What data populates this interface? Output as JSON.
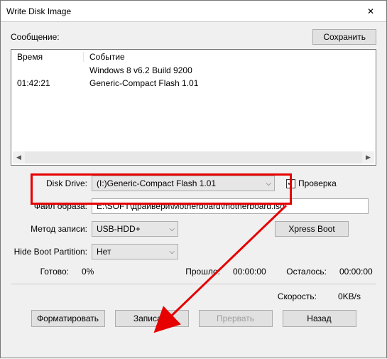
{
  "window": {
    "title": "Write Disk Image",
    "close_glyph": "✕"
  },
  "msg": {
    "label": "Сообщение:",
    "save_label": "Сохранить"
  },
  "log": {
    "header_time": "Время",
    "header_event": "Событие",
    "rows": [
      {
        "time": "",
        "event": "Windows 8 v6.2 Build 9200"
      },
      {
        "time": "01:42:21",
        "event": "Generic-Compact Flash   1.01"
      }
    ],
    "scroll_left": "◀",
    "scroll_right": "▶"
  },
  "form": {
    "disk_drive_label": "Disk Drive:",
    "disk_drive_value": "(I:)Generic-Compact Flash   1.01",
    "check_verify": "Проверка",
    "image_file_label": "Файл образа:",
    "image_file_value": "E:\\SOFT\\драйвери\\Motherboard\\motherboard.iso",
    "write_method_label": "Метод записи:",
    "write_method_value": "USB-HDD+",
    "xpress_boot": "Xpress Boot",
    "hide_boot_label": "Hide Boot Partition:",
    "hide_boot_value": "Нет",
    "chev": "⌵"
  },
  "progress": {
    "ready_label": "Готово:",
    "ready_value": "0%",
    "elapsed_label": "Прошло:",
    "elapsed_value": "00:00:00",
    "remain_label": "Осталось:",
    "remain_value": "00:00:00"
  },
  "speed": {
    "label": "Скорость:",
    "value": "0KB/s"
  },
  "buttons": {
    "format": "Форматировать",
    "write": "Записать",
    "abort": "Прервать",
    "back": "Назад"
  }
}
